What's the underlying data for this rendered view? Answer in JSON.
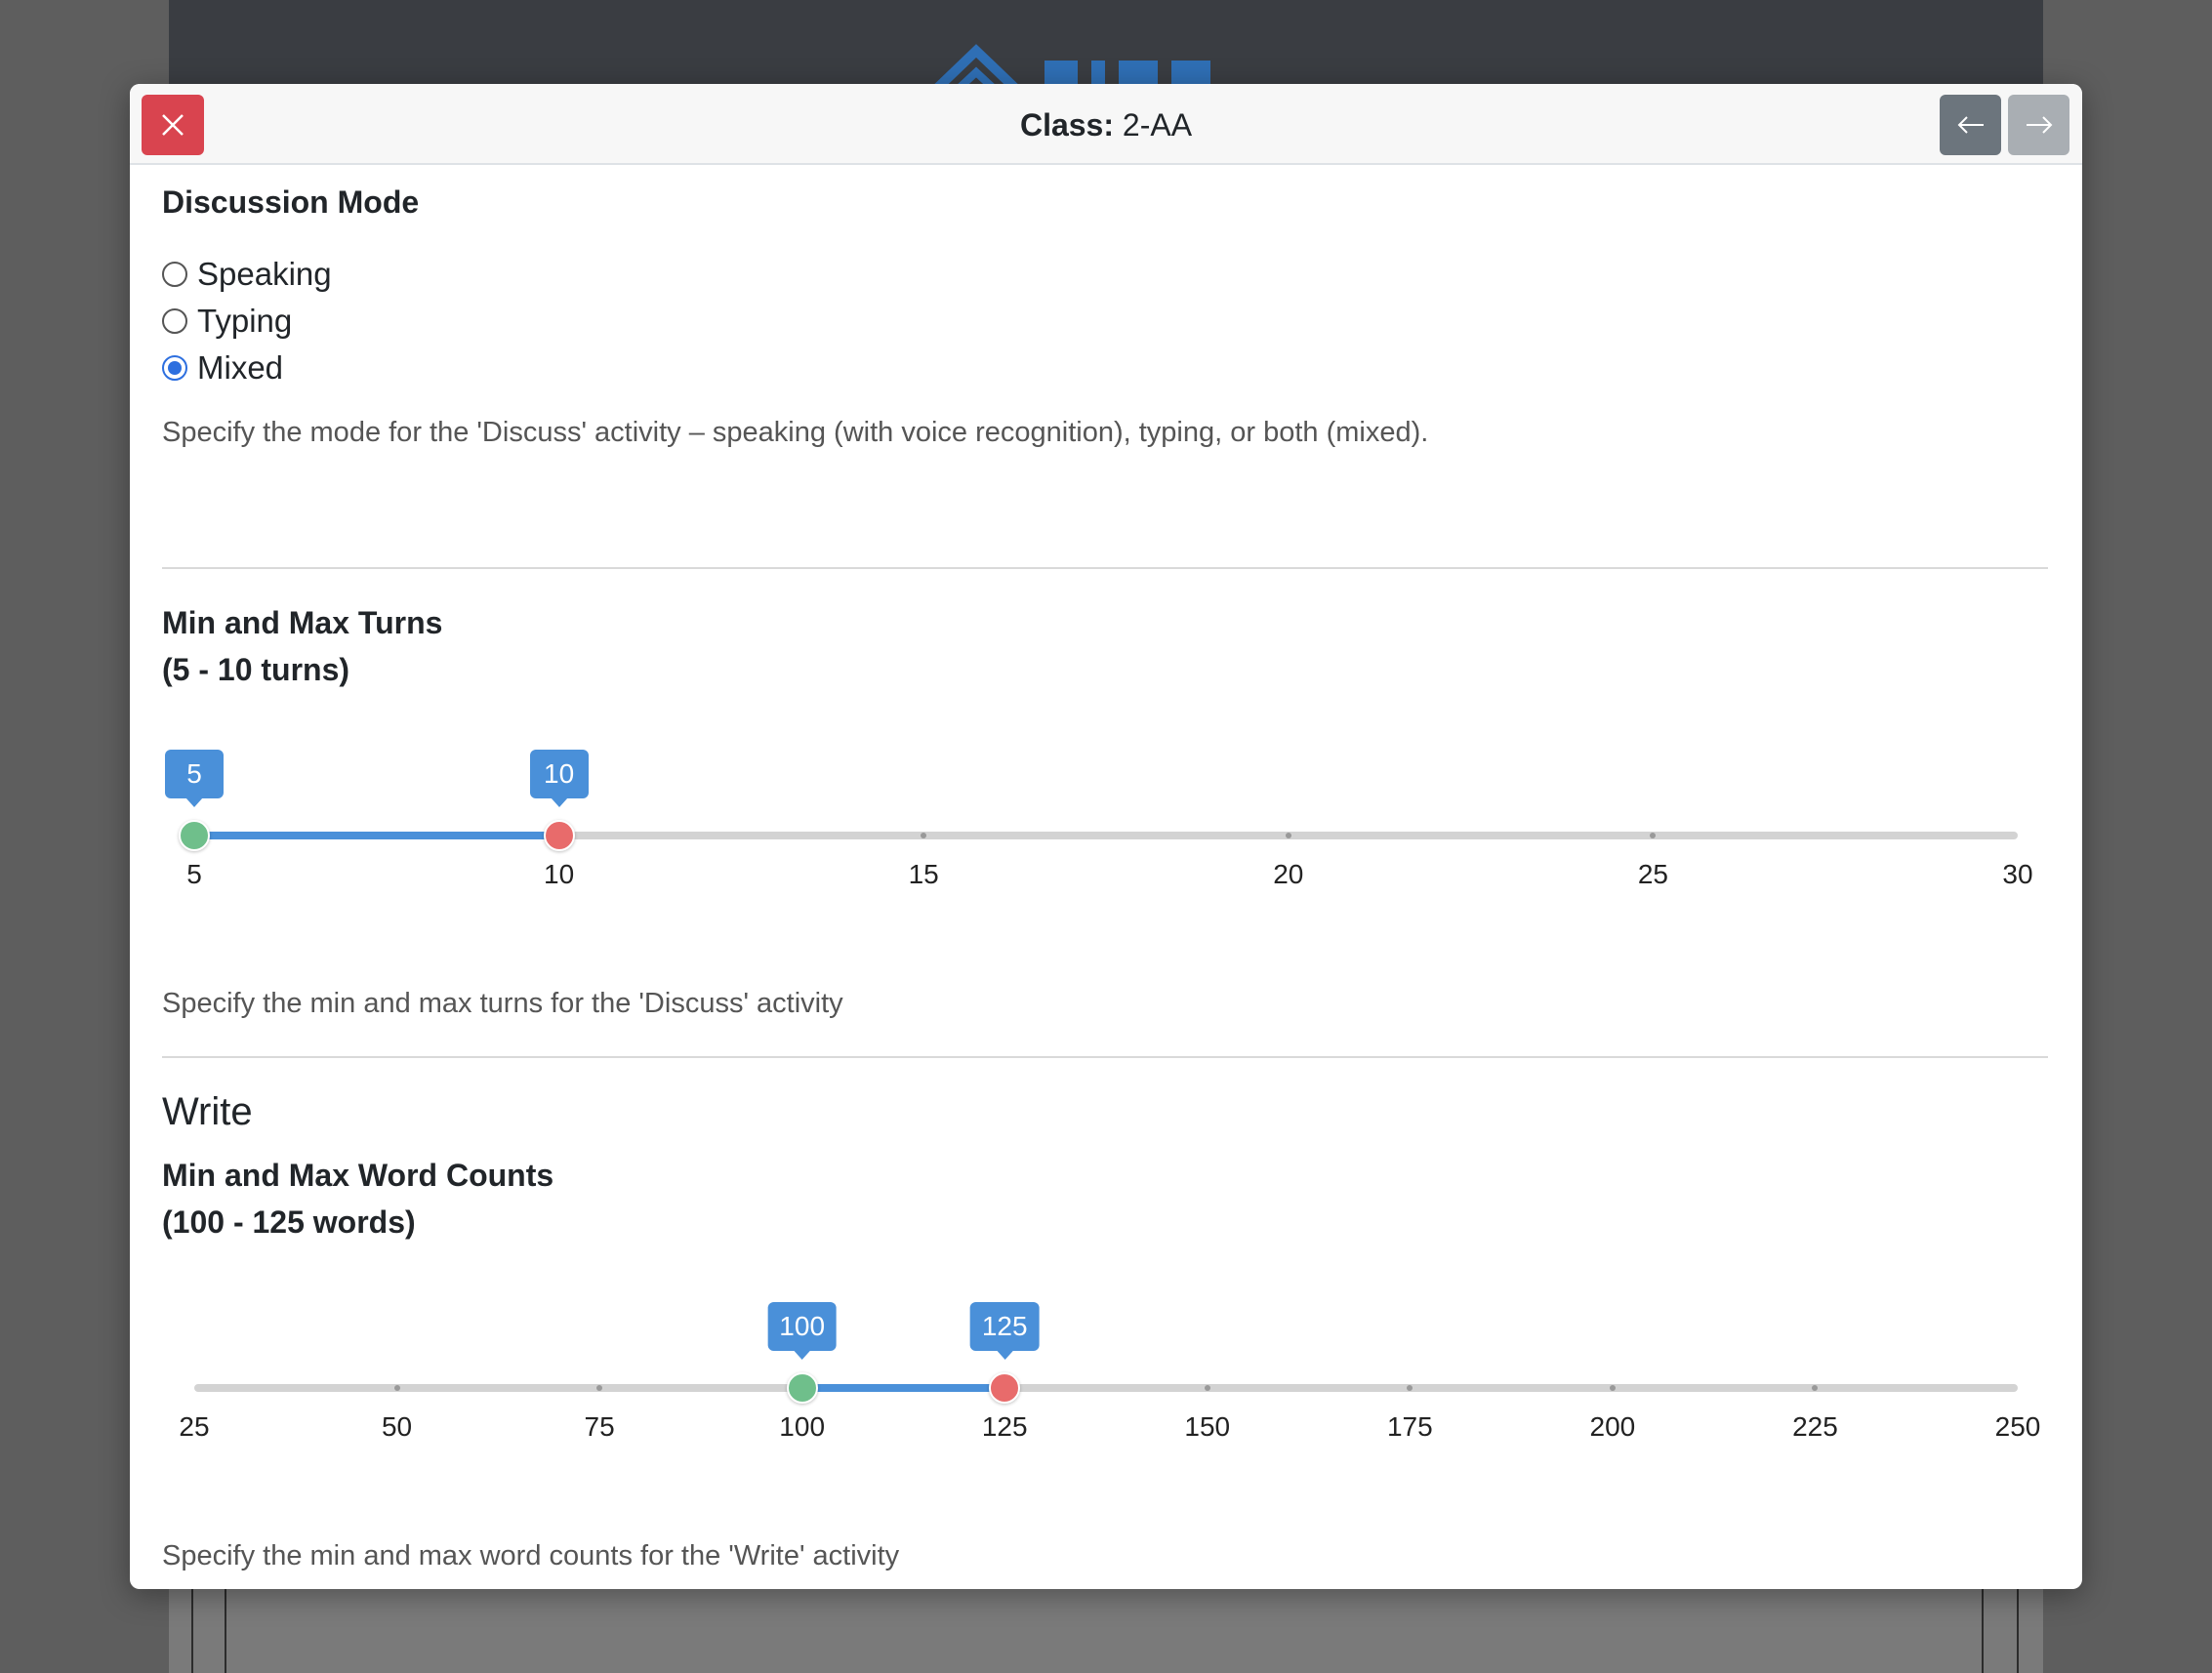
{
  "modal": {
    "title_label": "Class:",
    "title_value": "2-AA"
  },
  "discussion_mode": {
    "heading": "Discussion Mode",
    "options": [
      {
        "label": "Speaking",
        "checked": false
      },
      {
        "label": "Typing",
        "checked": false
      },
      {
        "label": "Mixed",
        "checked": true
      }
    ],
    "help": "Specify the mode for the 'Discuss' activity – speaking (with voice recognition), typing, or both (mixed)."
  },
  "turns": {
    "heading": "Min and Max Turns",
    "range_text": "(5 - 10 turns)",
    "min": 5,
    "max": 30,
    "value_min": 5,
    "value_max": 10,
    "scale_labels": [
      "5",
      "10",
      "15",
      "20",
      "25",
      "30"
    ],
    "tooltip_min": "5",
    "tooltip_max": "10",
    "help": "Specify the min and max turns for the 'Discuss' activity"
  },
  "write": {
    "section_title": "Write",
    "heading": "Min and Max Word Counts",
    "range_text": "(100 - 125 words)",
    "min": 25,
    "max": 250,
    "value_min": 100,
    "value_max": 125,
    "scale_labels": [
      "25",
      "50",
      "75",
      "100",
      "125",
      "150",
      "175",
      "200",
      "225",
      "250"
    ],
    "tooltip_min": "100",
    "tooltip_max": "125",
    "help": "Specify the min and max word counts for the 'Write' activity"
  },
  "colors": {
    "accent": "#4a90d9",
    "close": "#d9444f",
    "handle_min": "#6fbf8b",
    "handle_max": "#e86b6b",
    "primary": "#2e7bf0"
  }
}
